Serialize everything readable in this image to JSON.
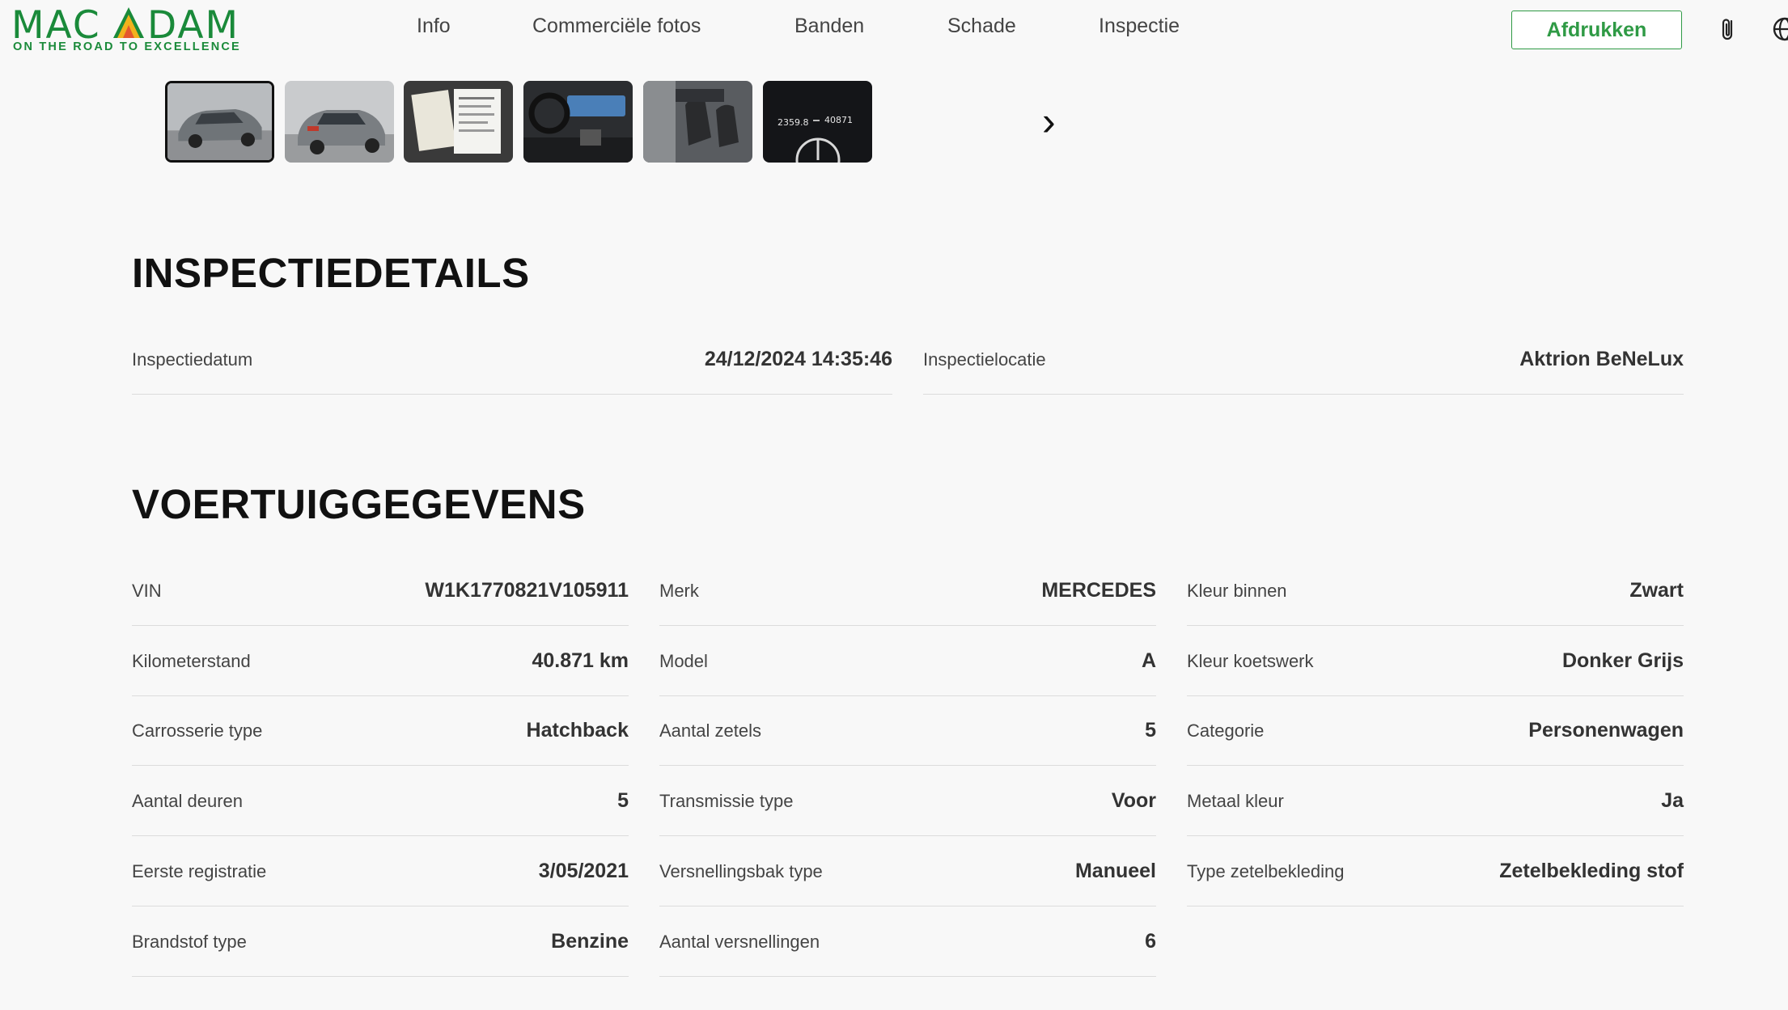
{
  "header": {
    "logo_text": "MACADAM",
    "logo_tagline": "ON THE ROAD TO EXCELLENCE",
    "nav": [
      "Info",
      "Commerciële fotos",
      "Banden",
      "Schade",
      "Inspectie"
    ],
    "print_label": "Afdrukken",
    "icons": [
      "paperclip-icon",
      "globe-icon"
    ]
  },
  "gallery": {
    "thumbnails": [
      "car-front-photo",
      "car-rear-photo",
      "documents-photo",
      "dashboard-photo",
      "front-seats-photo",
      "odometer-photo"
    ],
    "odometer_left": "2359.8",
    "odometer_right": "40871",
    "next_label": "›"
  },
  "inspection": {
    "title": "INSPECTIEDETAILS",
    "fields": [
      {
        "label": "Inspectiedatum",
        "value": "24/12/2024 14:35:46"
      },
      {
        "label": "Inspectielocatie",
        "value": "Aktrion BeNeLux"
      }
    ]
  },
  "vehicle": {
    "title": "VOERTUIGGEGEVENS",
    "columns": [
      [
        {
          "label": "VIN",
          "value": "W1K1770821V105911"
        },
        {
          "label": "Kilometerstand",
          "value": "40.871 km"
        },
        {
          "label": "Carrosserie type",
          "value": "Hatchback"
        },
        {
          "label": "Aantal deuren",
          "value": "5"
        },
        {
          "label": "Eerste registratie",
          "value": "3/05/2021"
        },
        {
          "label": "Brandstof type",
          "value": "Benzine"
        }
      ],
      [
        {
          "label": "Merk",
          "value": "MERCEDES"
        },
        {
          "label": "Model",
          "value": "A"
        },
        {
          "label": "Aantal zetels",
          "value": "5"
        },
        {
          "label": "Transmissie type",
          "value": "Voor"
        },
        {
          "label": "Versnellingsbak type",
          "value": "Manueel"
        },
        {
          "label": "Aantal versnellingen",
          "value": "6"
        }
      ],
      [
        {
          "label": "Kleur binnen",
          "value": "Zwart"
        },
        {
          "label": "Kleur koetswerk",
          "value": "Donker Grijs"
        },
        {
          "label": "Categorie",
          "value": "Personenwagen"
        },
        {
          "label": "Metaal kleur",
          "value": "Ja"
        },
        {
          "label": "Type zetelbekleding",
          "value": "Zetelbekleding stof"
        }
      ]
    ]
  },
  "colors": {
    "brand_green": "#1a8a3a",
    "button_green": "#2f9a45",
    "background": "#f8f8f8"
  }
}
